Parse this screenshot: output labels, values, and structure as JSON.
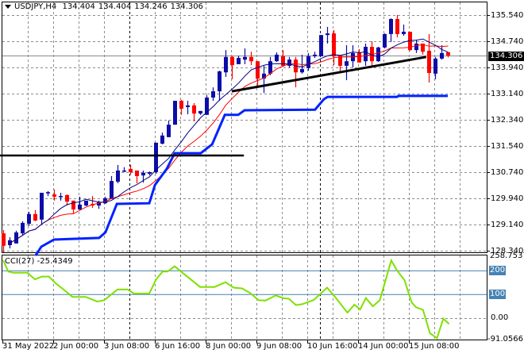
{
  "header": {
    "symbol": "USDJPY,H4",
    "open": "134.404",
    "high": "134.404",
    "low": "134.246",
    "close": "134.306"
  },
  "cci_header": {
    "name": "CCI(27)",
    "value": "-25.4349"
  },
  "colors": {
    "bull": "#0c0ca8",
    "bear": "#ff0000",
    "fast_ma": "#000080",
    "slow_ma": "#ff0000",
    "channel": "#0022ff",
    "cci": "#7fe000",
    "level": "#4682b4",
    "grid": "#8c8c8c"
  },
  "price_axis": [
    "135.540",
    "134.740",
    "133.940",
    "133.140",
    "132.340",
    "131.540",
    "130.740",
    "129.940",
    "129.140",
    "128.340"
  ],
  "current_price": "134.306",
  "cci_axis": {
    "max": "258.7537",
    "level_200": "200",
    "level_100": "100",
    "zero": "0.00",
    "min": "-91.0566"
  },
  "time_axis": [
    "31 May 2022",
    "2 Jun 00:00",
    "3 Jun 08:00",
    "6 Jun 16:00",
    "8 Jun 00:00",
    "9 Jun 08:00",
    "10 Jun 16:00",
    "14 Jun 00:00",
    "15 Jun 08:00"
  ],
  "chart_data": {
    "type": "candlestick",
    "symbol": "USDJPY",
    "timeframe": "H4",
    "ylim": [
      128.34,
      135.54
    ],
    "candles_ohlc": [
      [
        128.87,
        128.97,
        128.29,
        128.49
      ],
      [
        128.51,
        128.75,
        128.41,
        128.66
      ],
      [
        128.56,
        128.95,
        128.56,
        128.9
      ],
      [
        128.87,
        129.24,
        128.82,
        129.19
      ],
      [
        129.16,
        129.53,
        129.09,
        129.46
      ],
      [
        129.46,
        129.58,
        129.24,
        129.26
      ],
      [
        129.29,
        130.11,
        129.14,
        130.11
      ],
      [
        130.09,
        130.16,
        130.01,
        130.13
      ],
      [
        130.06,
        130.21,
        129.87,
        129.99
      ],
      [
        129.99,
        130.11,
        129.87,
        130.01
      ],
      [
        130.04,
        130.06,
        129.72,
        129.84
      ],
      [
        129.87,
        129.87,
        129.48,
        129.6
      ],
      [
        129.6,
        129.99,
        129.58,
        129.75
      ],
      [
        129.72,
        129.87,
        129.7,
        129.87
      ],
      [
        129.77,
        130.01,
        129.65,
        129.72
      ],
      [
        129.72,
        129.87,
        129.62,
        129.82
      ],
      [
        129.79,
        129.99,
        129.77,
        129.94
      ],
      [
        129.92,
        130.62,
        129.92,
        130.47
      ],
      [
        130.45,
        130.96,
        130.4,
        130.79
      ],
      [
        130.76,
        130.89,
        130.74,
        130.79
      ],
      [
        130.84,
        130.96,
        130.67,
        130.74
      ],
      [
        130.79,
        130.79,
        130.4,
        130.62
      ],
      [
        130.64,
        130.79,
        130.42,
        130.72
      ],
      [
        130.69,
        130.76,
        130.64,
        130.74
      ],
      [
        130.74,
        131.64,
        130.69,
        131.64
      ],
      [
        131.61,
        131.95,
        131.59,
        131.86
      ],
      [
        131.81,
        132.32,
        131.81,
        132.19
      ],
      [
        132.19,
        132.92,
        132.19,
        132.92
      ],
      [
        132.92,
        132.95,
        132.49,
        132.68
      ],
      [
        132.73,
        132.92,
        132.51,
        132.78
      ],
      [
        132.78,
        132.85,
        132.29,
        132.53
      ],
      [
        132.53,
        132.61,
        132.49,
        132.61
      ],
      [
        132.49,
        133.09,
        132.49,
        133.02
      ],
      [
        133.02,
        133.33,
        132.92,
        133.21
      ],
      [
        133.21,
        133.84,
        132.92,
        133.82
      ],
      [
        133.79,
        134.47,
        133.65,
        134.26
      ],
      [
        134.26,
        134.3,
        133.58,
        134.01
      ],
      [
        134.04,
        134.3,
        134.04,
        134.23
      ],
      [
        134.18,
        134.52,
        134.04,
        134.26
      ],
      [
        134.26,
        134.42,
        134.01,
        134.13
      ],
      [
        134.13,
        134.13,
        133.33,
        133.6
      ],
      [
        133.6,
        133.99,
        133.16,
        133.75
      ],
      [
        133.75,
        134.26,
        133.7,
        134.13
      ],
      [
        134.13,
        134.4,
        134.11,
        134.33
      ],
      [
        134.28,
        134.47,
        133.96,
        133.99
      ],
      [
        133.99,
        134.26,
        133.94,
        134.18
      ],
      [
        134.18,
        134.26,
        133.33,
        133.79
      ],
      [
        133.79,
        134.33,
        133.75,
        133.89
      ],
      [
        133.92,
        134.38,
        133.84,
        134.28
      ],
      [
        134.28,
        134.42,
        134.23,
        134.33
      ],
      [
        134.28,
        134.93,
        134.28,
        134.93
      ],
      [
        134.93,
        135.18,
        134.67,
        134.98
      ],
      [
        134.98,
        135.08,
        134.01,
        134.28
      ],
      [
        134.3,
        134.3,
        133.82,
        133.99
      ],
      [
        133.99,
        134.62,
        133.55,
        134.13
      ],
      [
        134.13,
        134.62,
        133.94,
        134.38
      ],
      [
        134.4,
        134.5,
        134.09,
        134.09
      ],
      [
        134.13,
        134.67,
        133.99,
        134.57
      ],
      [
        134.57,
        134.74,
        133.94,
        134.13
      ],
      [
        134.13,
        134.57,
        134.11,
        134.55
      ],
      [
        134.55,
        134.98,
        134.52,
        134.96
      ],
      [
        134.96,
        135.44,
        134.72,
        135.42
      ],
      [
        135.42,
        135.54,
        134.86,
        134.96
      ],
      [
        134.96,
        135.25,
        134.91,
        135.03
      ],
      [
        135.03,
        135.03,
        134.45,
        134.47
      ],
      [
        134.47,
        134.79,
        134.38,
        134.67
      ],
      [
        134.67,
        134.67,
        134.33,
        134.42
      ],
      [
        134.45,
        134.96,
        133.48,
        133.77
      ],
      [
        133.75,
        134.26,
        133.58,
        134.21
      ],
      [
        134.21,
        134.62,
        134.18,
        134.38
      ],
      [
        134.404,
        134.404,
        134.246,
        134.306
      ]
    ],
    "channel_line": [
      [
        5.1,
        128.19
      ],
      [
        6,
        128.46
      ],
      [
        8,
        128.68
      ],
      [
        15.1,
        128.73
      ],
      [
        16.1,
        128.9
      ],
      [
        17.9,
        129.77
      ],
      [
        23,
        129.79
      ],
      [
        23.9,
        130.35
      ],
      [
        25.75,
        130.84
      ],
      [
        27,
        131.32
      ],
      [
        31.1,
        131.32
      ],
      [
        32.9,
        131.59
      ],
      [
        34.9,
        132.49
      ],
      [
        37,
        132.49
      ],
      [
        38,
        132.63
      ],
      [
        49.1,
        132.65
      ],
      [
        50.5,
        132.97
      ],
      [
        51.1,
        133.04
      ],
      [
        62,
        133.04
      ],
      [
        62.25,
        133.07
      ],
      [
        70,
        133.07
      ]
    ],
    "support_horizontal": {
      "price": 131.25,
      "from_bar": -0.5,
      "to_bar": 37.9
    },
    "trendline": [
      [
        36,
        133.21
      ],
      [
        66.6,
        134.26
      ]
    ],
    "cci": {
      "ylim": [
        -91.0566,
        258.7537
      ],
      "levels": [
        200,
        100,
        0
      ],
      "points": [
        [
          0,
          245
        ],
        [
          0.8,
          197
        ],
        [
          1.6,
          192
        ],
        [
          3.8,
          192
        ],
        [
          5,
          164
        ],
        [
          6.1,
          176
        ],
        [
          7.2,
          176
        ],
        [
          8.2,
          149
        ],
        [
          9.5,
          121
        ],
        [
          10.9,
          90
        ],
        [
          13,
          90
        ],
        [
          14.8,
          70
        ],
        [
          15.9,
          76
        ],
        [
          18,
          121
        ],
        [
          19.6,
          121
        ],
        [
          20.6,
          104
        ],
        [
          23,
          104
        ],
        [
          24.1,
          165
        ],
        [
          25.1,
          197
        ],
        [
          25.9,
          197
        ],
        [
          27,
          219
        ],
        [
          28,
          197
        ],
        [
          31,
          132
        ],
        [
          33.3,
          132
        ],
        [
          35,
          152
        ],
        [
          36.3,
          129
        ],
        [
          37.6,
          126
        ],
        [
          38.9,
          106
        ],
        [
          40.2,
          76
        ],
        [
          41.3,
          74
        ],
        [
          42.9,
          96
        ],
        [
          44.2,
          84
        ],
        [
          45,
          82
        ],
        [
          46.1,
          55
        ],
        [
          47.1,
          59
        ],
        [
          48.9,
          77
        ],
        [
          51,
          129
        ],
        [
          52.4,
          85
        ],
        [
          54.2,
          23
        ],
        [
          55.3,
          57
        ],
        [
          56.2,
          37
        ],
        [
          57.1,
          85
        ],
        [
          58.2,
          50
        ],
        [
          59.3,
          76
        ],
        [
          61.1,
          244
        ],
        [
          62,
          202
        ],
        [
          63.2,
          160
        ],
        [
          64.3,
          67
        ],
        [
          65,
          46
        ],
        [
          66.1,
          35
        ],
        [
          67.2,
          -64
        ],
        [
          68.3,
          -85
        ],
        [
          69.3,
          -2
        ],
        [
          70.2,
          -25
        ]
      ]
    }
  }
}
